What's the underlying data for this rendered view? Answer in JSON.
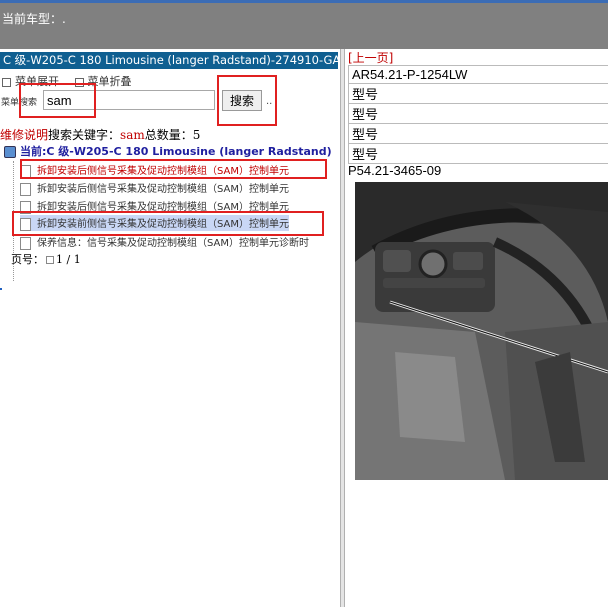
{
  "topbar": {
    "current_model_label": "当前车型：."
  },
  "left": {
    "model_title": "C 级-W205-C 180 Limousine (langer Radstand)-274910-GA",
    "menu": {
      "expand": "菜单展开",
      "collapse": "菜单折叠"
    },
    "search": {
      "label": "菜单搜索",
      "value": "sam",
      "button": "搜索",
      "more": ".."
    },
    "result": {
      "repair_label": "维修说明",
      "keyword_label": "搜索关键字：",
      "keyword": "sam",
      "count_label": "总数量：",
      "count": "5"
    },
    "current_label": "当前:C 级-W205-C 180 Limousine (langer Radstand)",
    "items": [
      "拆卸安装后侧信号采集及促动控制模组（SAM）控制单元",
      "拆卸安装后侧信号采集及促动控制模组（SAM）控制单元",
      "拆卸安装后侧信号采集及促动控制模组（SAM）控制单元",
      "拆卸安装前侧信号采集及促动控制模组（SAM）控制单元",
      "保养信息：信号采集及促动控制模组（SAM）控制单元诊断时"
    ],
    "pagination": {
      "label": "页号：",
      "value": "1 / 1"
    }
  },
  "right": {
    "prev_link": "[上一页]",
    "doc_code": "AR54.21-P-1254LW",
    "rows": [
      "型号",
      "型号",
      "型号",
      "型号"
    ],
    "figure_code": "P54.21-3465-09"
  },
  "colors": {
    "model_bar": "#0f5f91",
    "highlight": "#c9d7f5",
    "annotation_red": "#e02020",
    "topbar": "#808080"
  }
}
